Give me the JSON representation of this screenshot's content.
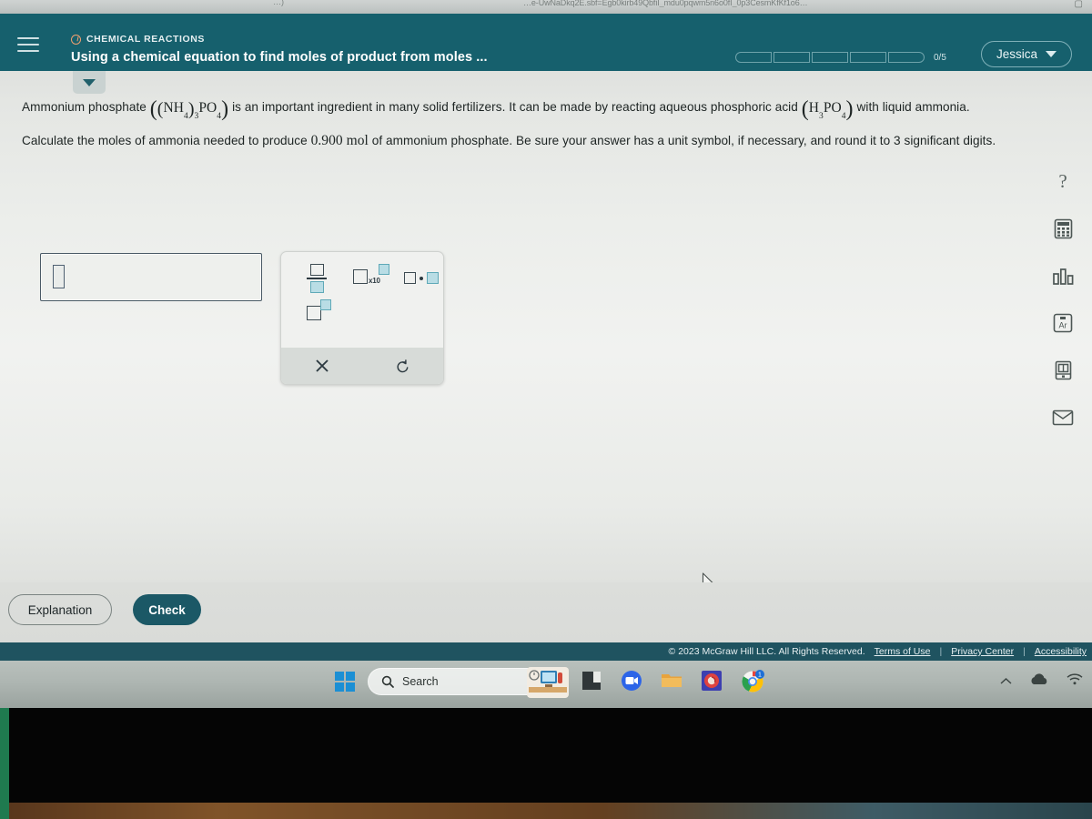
{
  "browser": {
    "url_fragment": "…e-UwNaDkq2E.sbf=Egb0kirb49QbfiI_mdu0pqwm5n6o0fI_0p3CesmKfKf1o6…",
    "left_fragment": "…)",
    "bookmark_icon": "bookmark-icon"
  },
  "header": {
    "menu_icon": "hamburger-menu-icon",
    "category_icon": "alo-chemistry-icon",
    "category": "CHEMICAL REACTIONS",
    "topic_title": "Using a chemical equation to find moles of product from moles ...",
    "progress": {
      "segments": 5,
      "completed": 0,
      "label": "0/5"
    },
    "user": {
      "name": "Jessica",
      "chevron_icon": "chevron-down-icon"
    },
    "bg_color": "#16606d"
  },
  "tab": {
    "chevron_icon": "chevron-down-icon"
  },
  "question": {
    "line1_a": "Ammonium phosphate",
    "formula1": "((NH4)3PO4)",
    "formula1_parts": {
      "open": "(",
      "open2": "(",
      "n": "NH",
      "n_sub": "4",
      "close2": ")",
      "close2_sub": "3",
      "po": "PO",
      "po_sub": "4",
      "close": ")"
    },
    "line1_b": "is an important ingredient in many solid fertilizers. It can be made by reacting aqueous phosphoric acid",
    "formula2_parts": {
      "open": "(",
      "h": "H",
      "h_sub": "3",
      "po": "PO",
      "po_sub": "4",
      "close": ")"
    },
    "line1_c": "with",
    "line2_a": "liquid ammonia. Calculate the moles of ammonia needed to produce",
    "value": "0.900 mol",
    "line2_b": "of ammonium phosphate. Be sure your answer has a unit symbol, if necessary,",
    "line3": "and round it to 3 significant digits."
  },
  "answer": {
    "value": "",
    "caret_name": "answer-placeholder-box"
  },
  "palette": {
    "buttons": [
      {
        "name": "fraction-button",
        "label": "fraction"
      },
      {
        "name": "scientific-notation-button",
        "label": "x10"
      },
      {
        "name": "multiplication-dot-button",
        "label": "dot"
      },
      {
        "name": "superscript-button",
        "label": "exponent"
      }
    ],
    "clear_icon": "close-x-icon",
    "undo_icon": "undo-icon"
  },
  "rail": [
    {
      "name": "help-icon",
      "glyph": "?"
    },
    {
      "name": "calculator-icon",
      "glyph": "calculator"
    },
    {
      "name": "bar-chart-icon",
      "glyph": "chart"
    },
    {
      "name": "periodic-table-icon",
      "glyph": "Ar"
    },
    {
      "name": "reference-book-icon",
      "glyph": "book"
    },
    {
      "name": "message-envelope-icon",
      "glyph": "envelope"
    }
  ],
  "periodic_symbol": "Ar",
  "actions": {
    "explanation_label": "Explanation",
    "check_label": "Check",
    "check_color": "#1b5866"
  },
  "footer": {
    "copyright": "© 2023 McGraw Hill LLC. All Rights Reserved.",
    "links": [
      "Terms of Use",
      "Privacy Center",
      "Accessibility"
    ],
    "separator": "|",
    "bg_color": "#1f5360"
  },
  "taskbar": {
    "start_icon": "windows-start-icon",
    "search_placeholder": "Search",
    "search_icon": "search-icon",
    "apps": [
      {
        "name": "taskbar-widgets-icon"
      },
      {
        "name": "taskbar-file-explorer-icon"
      },
      {
        "name": "taskbar-zoom-icon"
      },
      {
        "name": "taskbar-folder-icon"
      },
      {
        "name": "taskbar-photos-icon"
      },
      {
        "name": "taskbar-chrome-icon",
        "badge": "1"
      }
    ],
    "tray": [
      {
        "name": "tray-chevron-up-icon",
        "glyph": "^"
      },
      {
        "name": "tray-onedrive-cloud-icon",
        "glyph": "cloud"
      },
      {
        "name": "tray-wifi-icon",
        "glyph": "wifi"
      }
    ]
  }
}
